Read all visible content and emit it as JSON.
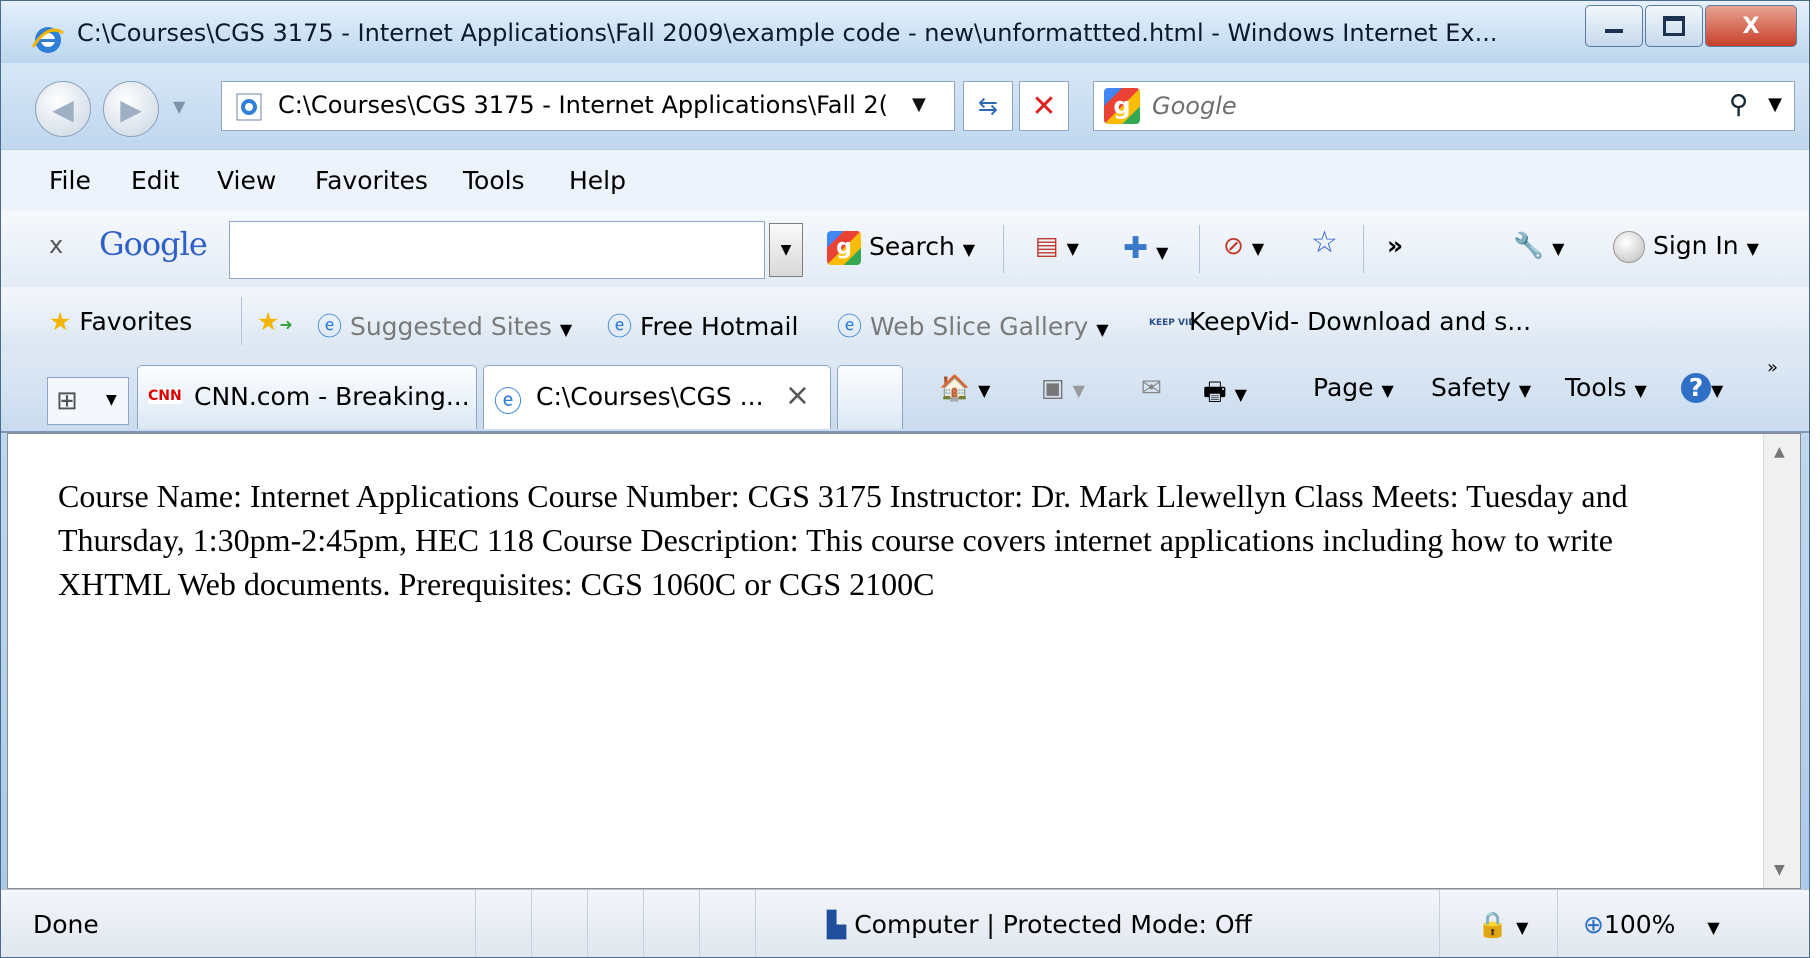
{
  "window": {
    "title": "C:\\Courses\\CGS 3175 - Internet Applications\\Fall 2009\\example code - new\\unformattted.html - Windows Internet Ex...",
    "minimize_icon": "minimize-icon",
    "maximize_icon": "maximize-icon",
    "close_label": "X"
  },
  "address_bar": {
    "url": "C:\\Courses\\CGS 3175 - Internet Applications\\Fall 2(",
    "search_placeholder": "Google"
  },
  "menu": [
    "File",
    "Edit",
    "View",
    "Favorites",
    "Tools",
    "Help"
  ],
  "google_toolbar": {
    "close": "x",
    "logo": "Google",
    "search_label": "Search",
    "more": "»",
    "sign_in": "Sign In"
  },
  "favorites_bar": {
    "favorites": "Favorites",
    "suggested_sites": "Suggested Sites",
    "free_hotmail": "Free Hotmail",
    "web_slice_gallery": "Web Slice Gallery",
    "keepvid": "KeepVid- Download and s...",
    "keepvid_icon_text": "KEEP VID"
  },
  "tabs": [
    {
      "label": "CNN.com - Breaking...",
      "badge": "CNN"
    },
    {
      "label": "C:\\Courses\\CGS ...",
      "close": "×"
    }
  ],
  "command_bar": {
    "page": "Page",
    "safety": "Safety",
    "tools": "Tools",
    "chevron": "»"
  },
  "document": {
    "text": "Course Name: Internet Applications Course Number: CGS 3175 Instructor: Dr. Mark Llewellyn Class Meets: Tuesday and Thursday, 1:30pm-2:45pm, HEC 118 Course Description: This course covers internet applications including how to write XHTML Web documents. Prerequisites: CGS 1060C or CGS 2100C"
  },
  "status_bar": {
    "status": "Done",
    "zone": "Computer | Protected Mode: Off",
    "zoom": "100%"
  },
  "colors": {
    "chrome_blue": "#cfe3f5",
    "close_red": "#c8402a",
    "stop_red": "#dd2222"
  }
}
